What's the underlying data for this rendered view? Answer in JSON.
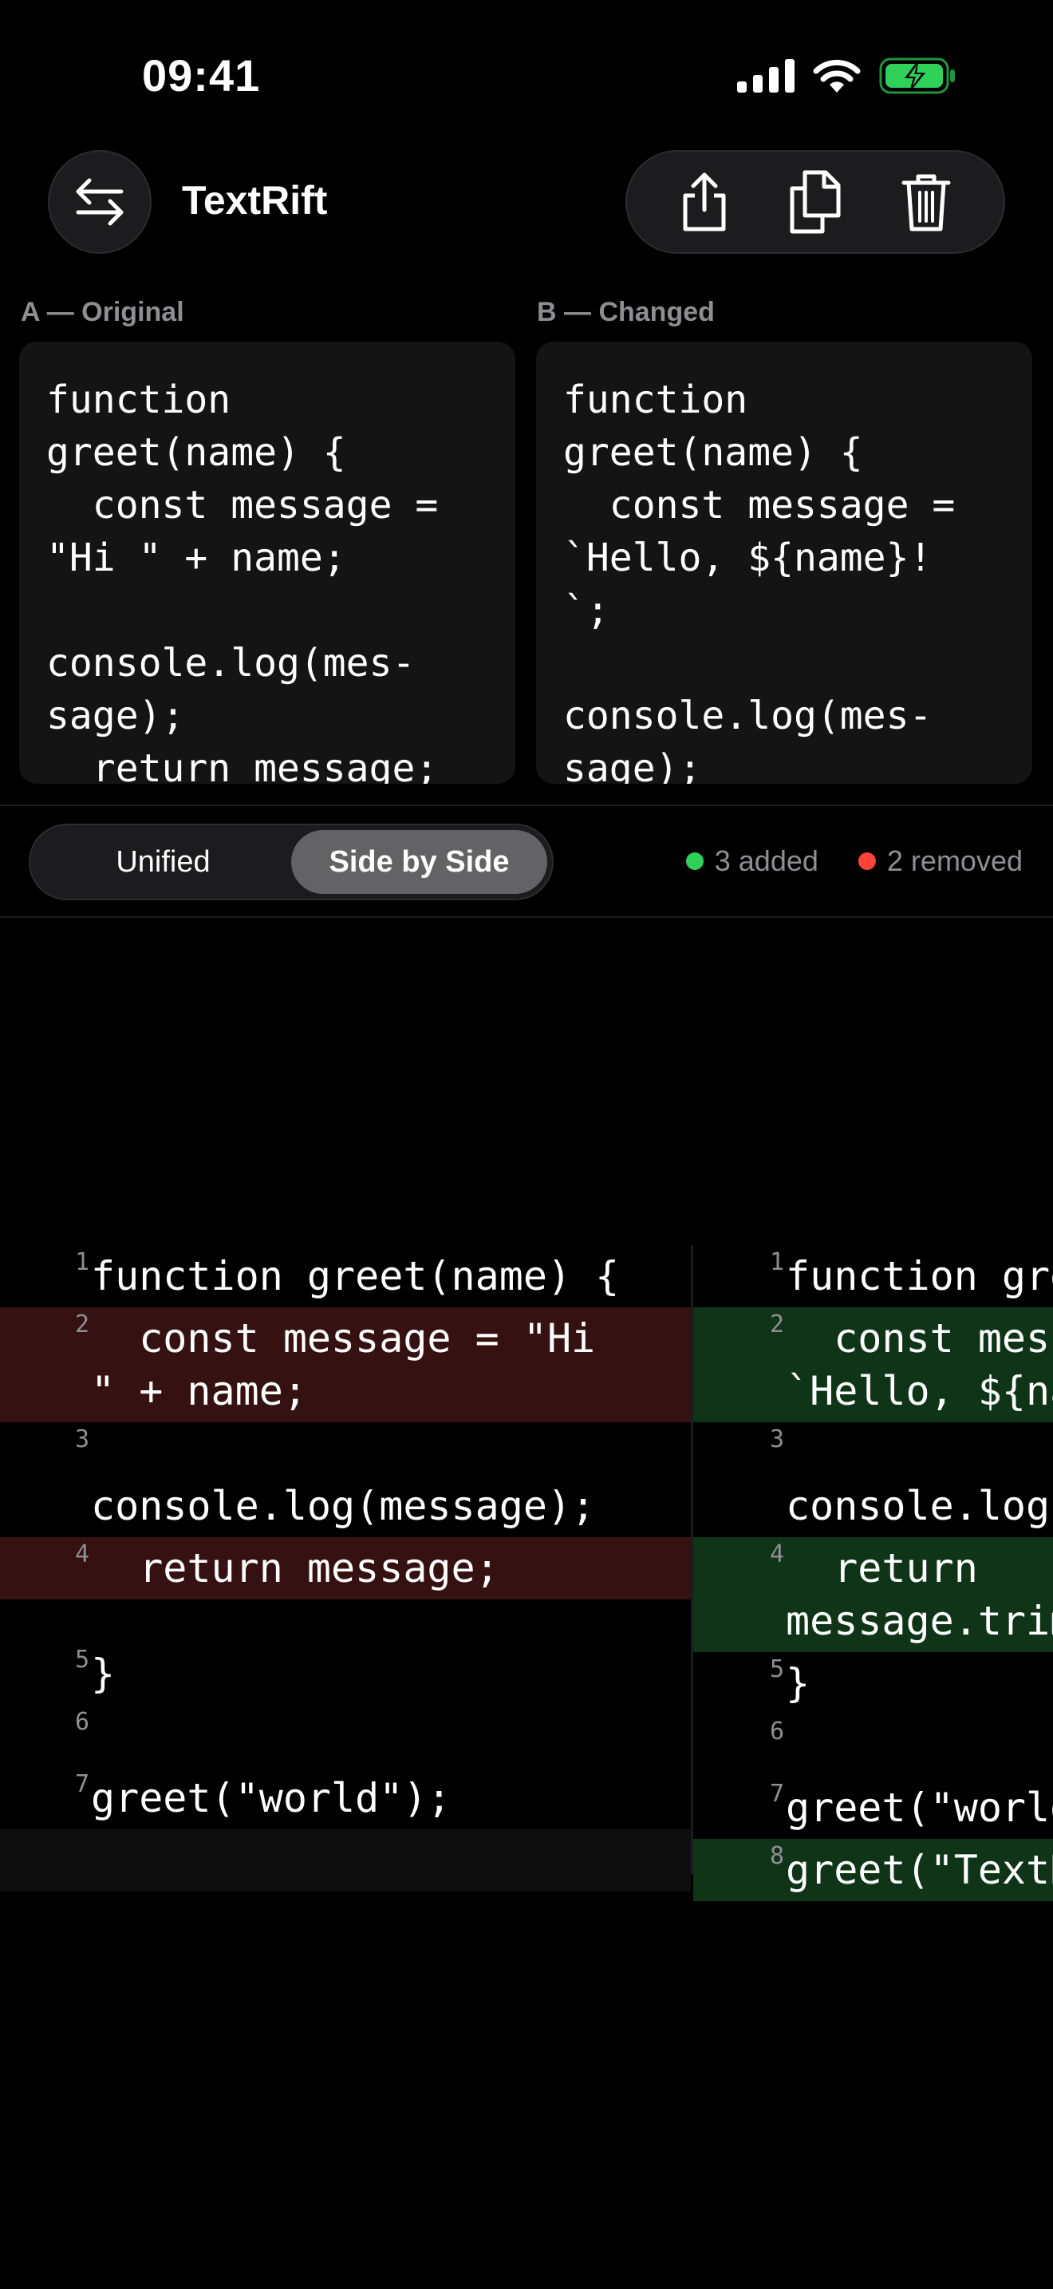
{
  "status": {
    "time": "09:41"
  },
  "header": {
    "title": "TextRift"
  },
  "panes": {
    "a": {
      "label": "A — Original",
      "text": "function\ngreet(name) {\n  const message =\n\"Hi \" + name;\n\nconsole.log(mes-\nsage);\n  return message;"
    },
    "b": {
      "label": "B — Changed",
      "text": "function\ngreet(name) {\n  const message =\n`Hello, ${name}!\n`;\n\nconsole.log(mes-\nsage);"
    }
  },
  "view_mode": {
    "options": [
      "Unified",
      "Side by Side"
    ],
    "selected": "Side by Side"
  },
  "stats": {
    "added": "3 added",
    "removed": "2 removed",
    "added_color": "#30d158",
    "removed_color": "#ff453a"
  },
  "diff": {
    "left": [
      {
        "n": "1",
        "text": "function greet(name) {",
        "kind": "same"
      },
      {
        "n": "2",
        "text": "  const message = \"Hi\n\" + name;",
        "kind": "removed"
      },
      {
        "n": "3",
        "text": "\nconsole.log(message);",
        "kind": "same"
      },
      {
        "n": "4",
        "text": "  return message;",
        "kind": "removed"
      },
      {
        "n": "",
        "text": "",
        "kind": "spacer"
      },
      {
        "n": "5",
        "text": "}",
        "kind": "same"
      },
      {
        "n": "6",
        "text": "",
        "kind": "same"
      },
      {
        "n": "7",
        "text": "greet(\"world\");",
        "kind": "same"
      },
      {
        "n": "",
        "text": " ",
        "kind": "placeholder"
      }
    ],
    "right": [
      {
        "n": "1",
        "text": "function greet(name) {",
        "kind": "same"
      },
      {
        "n": "2",
        "text": "  const message =\n`Hello, ${name}!`;",
        "kind": "added"
      },
      {
        "n": "3",
        "text": "\nconsole.log(message);",
        "kind": "same"
      },
      {
        "n": "4",
        "text": "  return\nmessage.trim();",
        "kind": "added"
      },
      {
        "n": "5",
        "text": "}",
        "kind": "same"
      },
      {
        "n": "6",
        "text": "",
        "kind": "same"
      },
      {
        "n": "7",
        "text": "greet(\"world\");",
        "kind": "same"
      },
      {
        "n": "8",
        "text": "greet(\"TextRift\");",
        "kind": "added"
      }
    ]
  }
}
